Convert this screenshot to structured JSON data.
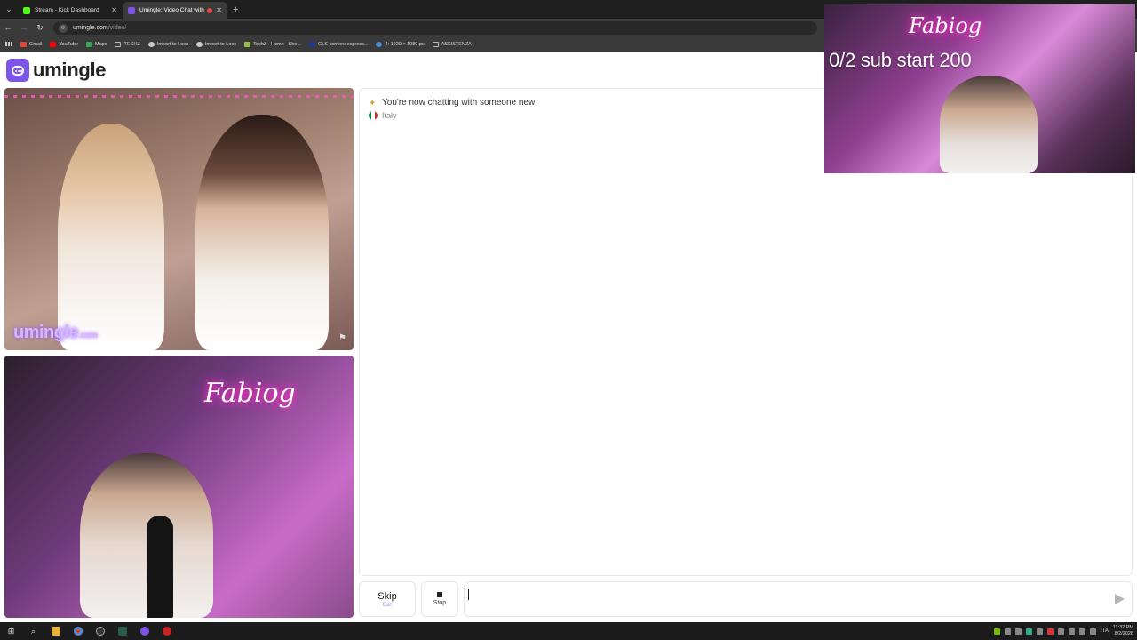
{
  "browser": {
    "tabs": [
      {
        "title": "Stream - Kick Dashboard",
        "favicon_color": "#53fc18",
        "active": false
      },
      {
        "title": "Umingle: Video Chat with S",
        "favicon_color": "#7c55e8",
        "active": true
      }
    ],
    "url_host": "umingle.com",
    "url_path": "/video/",
    "bookmarks": [
      {
        "label": "Gmail",
        "color": "#ea4335",
        "type": "icon"
      },
      {
        "label": "YouTube",
        "color": "#ff0000",
        "type": "icon"
      },
      {
        "label": "Maps",
        "color": "#34a853",
        "type": "icon"
      },
      {
        "label": "TECHZ",
        "color": "",
        "type": "folder"
      },
      {
        "label": "Import to Loox",
        "color": "#cccccc",
        "type": "icon"
      },
      {
        "label": "Import to Loox",
        "color": "#cccccc",
        "type": "icon"
      },
      {
        "label": "TechZ - Home - Sho...",
        "color": "#95bf47",
        "type": "icon"
      },
      {
        "label": "GLS corriere espress...",
        "color": "#1b3a8c",
        "type": "icon"
      },
      {
        "label": "4: 1920 × 1080 px",
        "color": "#4a90d9",
        "type": "icon"
      },
      {
        "label": "ASSISTENZA",
        "color": "",
        "type": "folder"
      }
    ]
  },
  "site": {
    "logo_text": "umingle",
    "brand_color": "#7c55e8"
  },
  "stranger_video": {
    "watermark": "umingle",
    "watermark_suffix": ".com"
  },
  "self_video": {
    "neon_sign": "Fabiog"
  },
  "chat": {
    "system_message": "You're now chatting with someone new",
    "country": "Italy"
  },
  "controls": {
    "skip_label": "Skip",
    "skip_hint": "Esc",
    "stop_label": "Stop",
    "message_value": ""
  },
  "overlay": {
    "text": "0/2 sub start 200",
    "neon_sign": "Fabiog"
  },
  "taskbar": {
    "time": "11:32 PM",
    "date": "8/2/2026",
    "language": "ITA"
  }
}
